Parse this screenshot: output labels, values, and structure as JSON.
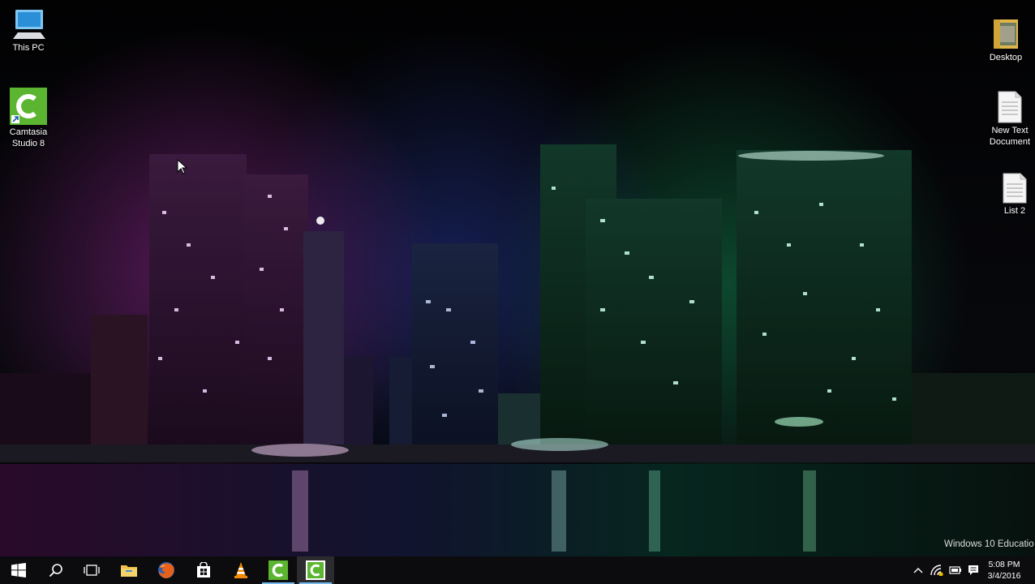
{
  "desktop": {
    "icons_left": [
      {
        "label": "This PC",
        "icon": "this-pc-icon"
      },
      {
        "label": "Camtasia Studio 8",
        "icon": "camtasia-icon"
      }
    ],
    "icons_right": [
      {
        "label": "Desktop",
        "icon": "folder-icon"
      },
      {
        "label": "New Text Document",
        "icon": "text-document-icon"
      },
      {
        "label": "List 2",
        "icon": "text-document-icon"
      }
    ],
    "watermark": "Windows 10 Educatio",
    "wallpaper": "night-city-skyline"
  },
  "taskbar": {
    "buttons": [
      {
        "name": "start",
        "icon": "windows-logo-icon"
      },
      {
        "name": "search",
        "icon": "search-icon"
      },
      {
        "name": "task-view",
        "icon": "task-view-icon"
      },
      {
        "name": "file-explorer",
        "icon": "folder-icon"
      },
      {
        "name": "firefox",
        "icon": "firefox-icon"
      },
      {
        "name": "store",
        "icon": "store-icon"
      },
      {
        "name": "vlc",
        "icon": "vlc-cone-icon"
      },
      {
        "name": "camtasia-studio",
        "icon": "camtasia-icon"
      },
      {
        "name": "camtasia-recorder",
        "icon": "camtasia-icon",
        "active": true
      }
    ],
    "tray": {
      "icons": [
        "chevron-up-icon",
        "wifi-icon",
        "battery-icon",
        "speaker-icon",
        "action-center-icon"
      ],
      "time": "5:08 PM",
      "date": "3/4/2016"
    }
  },
  "colors": {
    "taskbar": "#0c0c0f",
    "active_underline": "#76b9ed",
    "camtasia_green": "#5cb531",
    "firefox_orange": "#e8611a",
    "vlc_orange": "#f08a00"
  }
}
